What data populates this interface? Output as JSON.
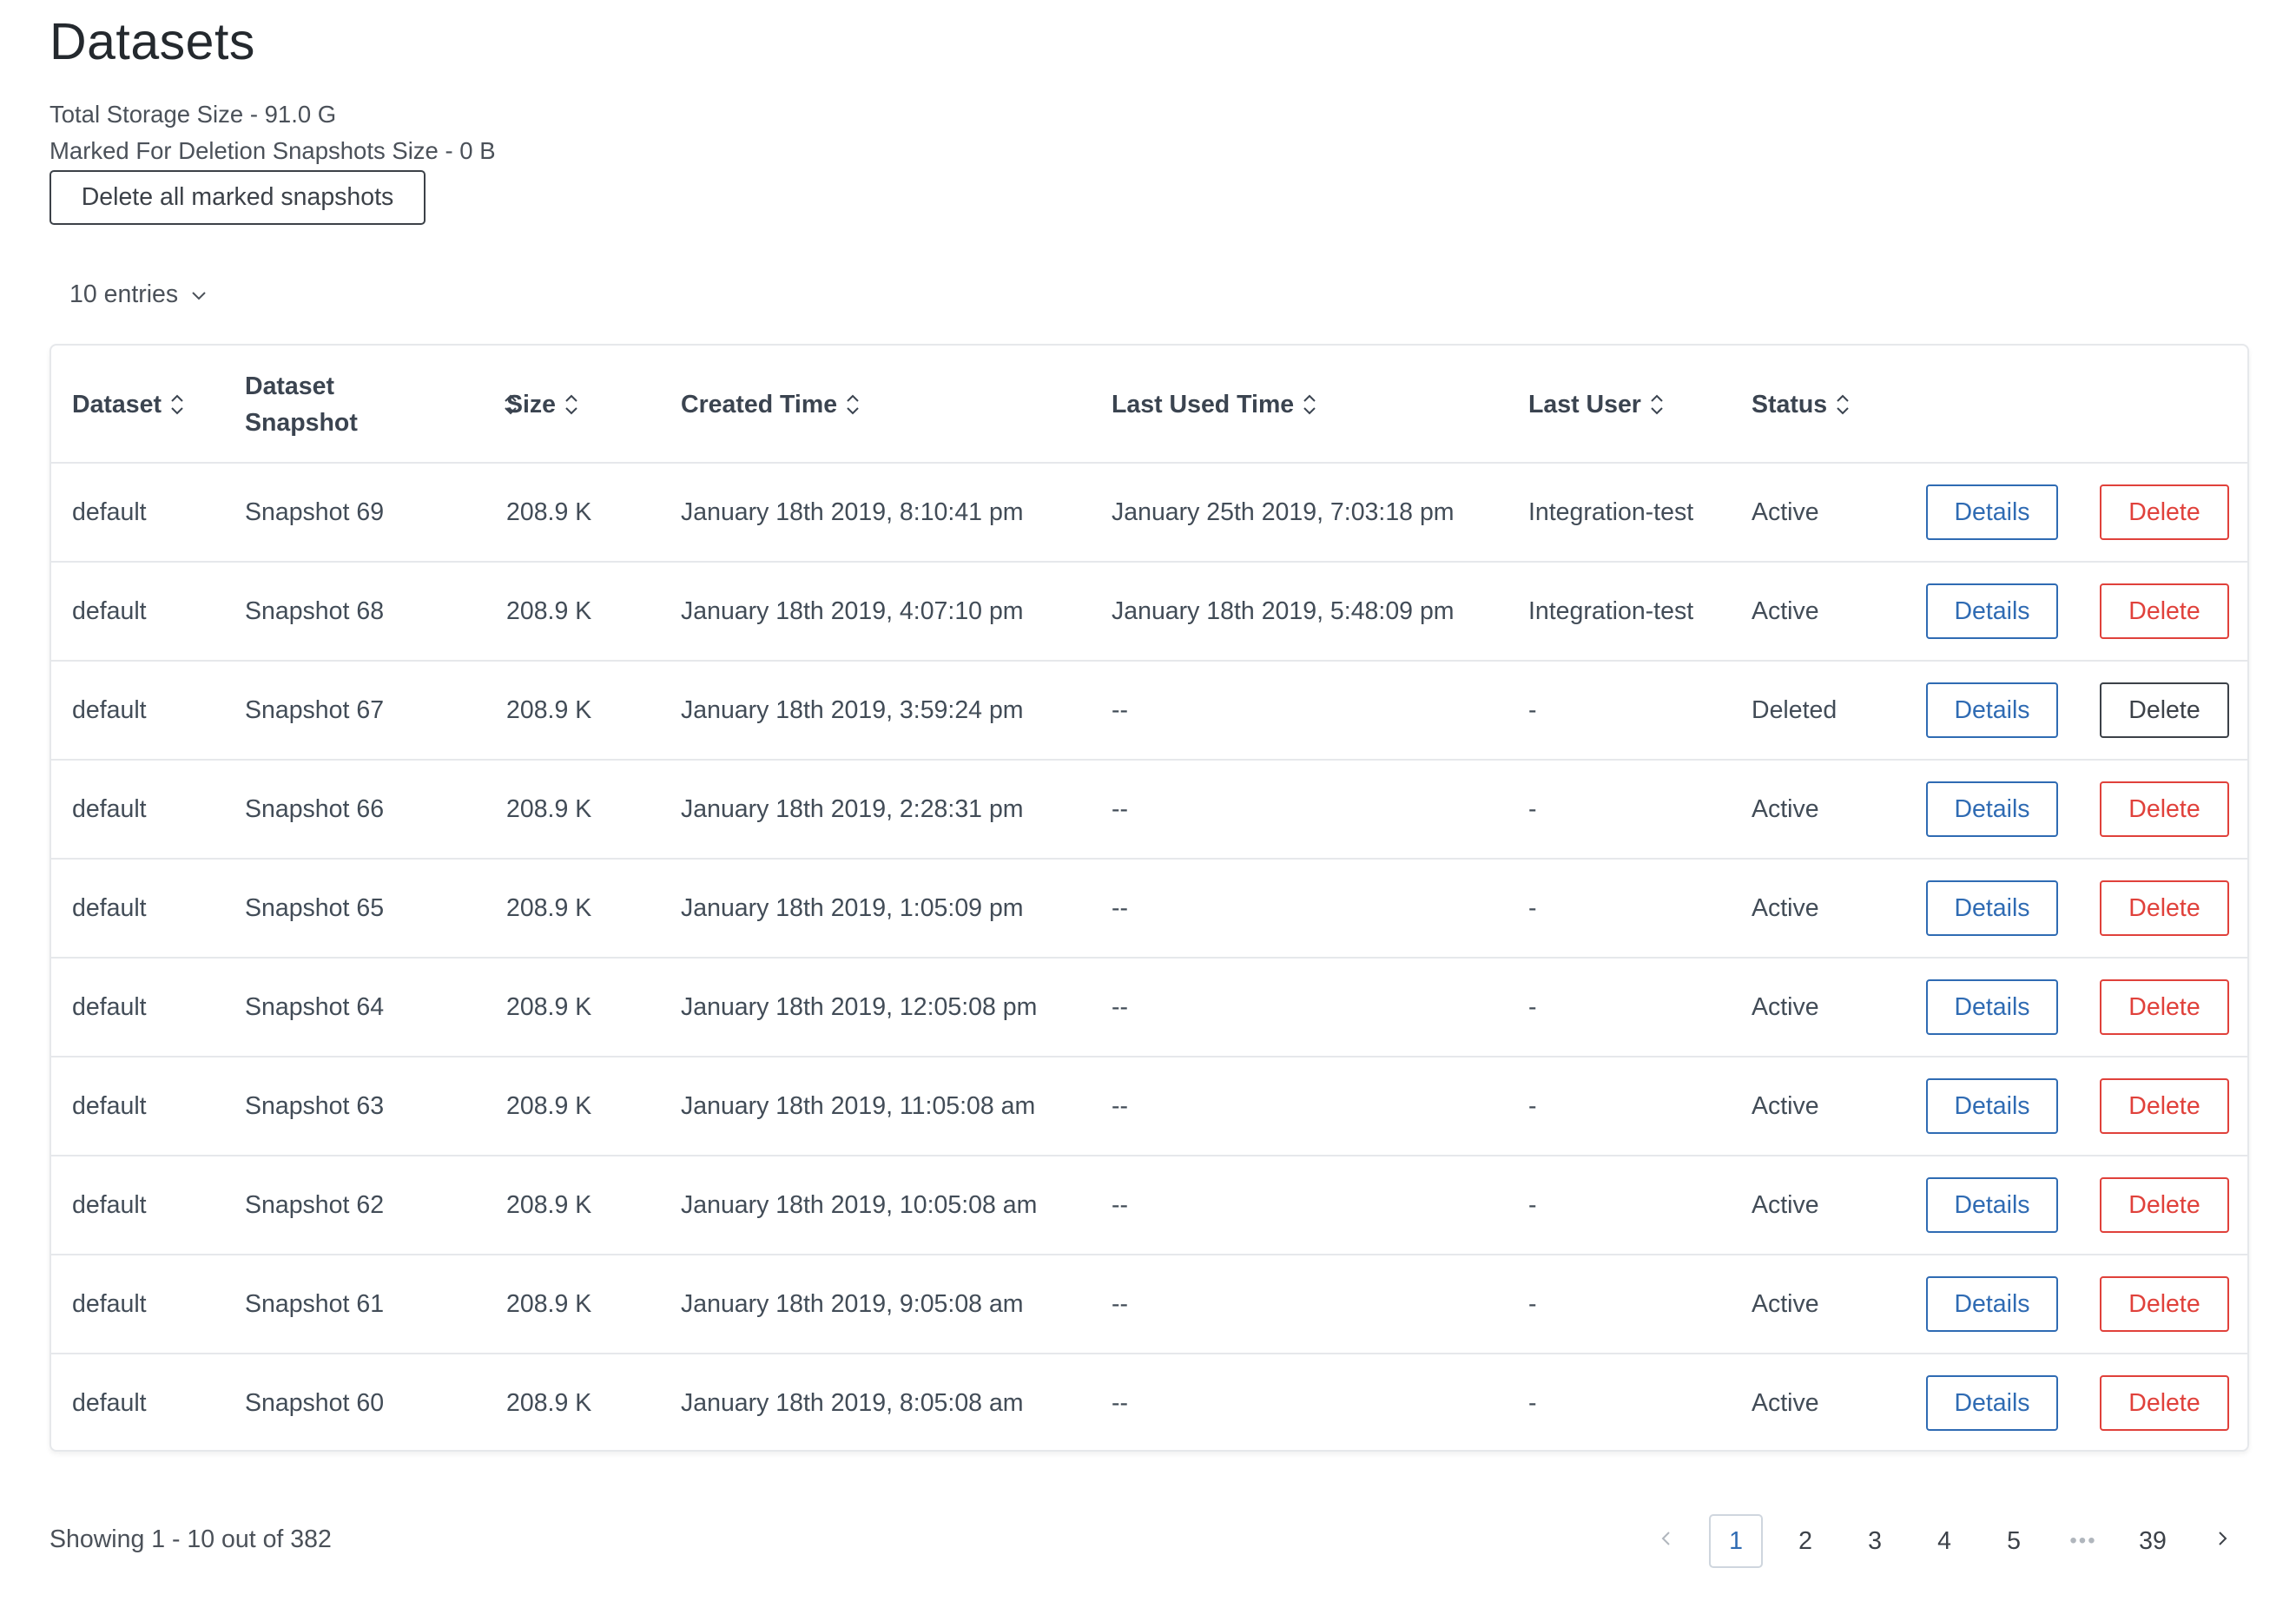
{
  "page": {
    "title": "Datasets",
    "total_storage": "Total Storage Size - 91.0 G",
    "marked_size": "Marked For Deletion Snapshots Size - 0 B",
    "delete_marked_label": "Delete all marked snapshots",
    "entries_label": "10 entries"
  },
  "table": {
    "headers": {
      "dataset": "Dataset",
      "snapshot_1": "Dataset",
      "snapshot_2": "Snapshot",
      "size": "Size",
      "created": "Created Time",
      "last_used": "Last Used Time",
      "last_user": "Last User",
      "status": "Status"
    },
    "rows": [
      {
        "dataset": "default",
        "snapshot": "Snapshot 69",
        "size": "208.9 K",
        "created": "January 18th 2019, 8:10:41 pm",
        "last_used": "January 25th 2019, 7:03:18 pm",
        "last_user": "Integration-test",
        "status": "Active",
        "details": "Details",
        "delete": "Delete"
      },
      {
        "dataset": "default",
        "snapshot": "Snapshot 68",
        "size": "208.9 K",
        "created": "January 18th 2019, 4:07:10 pm",
        "last_used": "January 18th 2019, 5:48:09 pm",
        "last_user": "Integration-test",
        "status": "Active",
        "details": "Details",
        "delete": "Delete"
      },
      {
        "dataset": "default",
        "snapshot": "Snapshot 67",
        "size": "208.9 K",
        "created": "January 18th 2019, 3:59:24 pm",
        "last_used": "--",
        "last_user": "-",
        "status": "Deleted",
        "details": "Details",
        "delete": "Delete"
      },
      {
        "dataset": "default",
        "snapshot": "Snapshot 66",
        "size": "208.9 K",
        "created": "January 18th 2019, 2:28:31 pm",
        "last_used": "--",
        "last_user": "-",
        "status": "Active",
        "details": "Details",
        "delete": "Delete"
      },
      {
        "dataset": "default",
        "snapshot": "Snapshot 65",
        "size": "208.9 K",
        "created": "January 18th 2019, 1:05:09 pm",
        "last_used": "--",
        "last_user": "-",
        "status": "Active",
        "details": "Details",
        "delete": "Delete"
      },
      {
        "dataset": "default",
        "snapshot": "Snapshot 64",
        "size": "208.9 K",
        "created": "January 18th 2019, 12:05:08 pm",
        "last_used": "--",
        "last_user": "-",
        "status": "Active",
        "details": "Details",
        "delete": "Delete"
      },
      {
        "dataset": "default",
        "snapshot": "Snapshot 63",
        "size": "208.9 K",
        "created": "January 18th 2019, 11:05:08 am",
        "last_used": "--",
        "last_user": "-",
        "status": "Active",
        "details": "Details",
        "delete": "Delete"
      },
      {
        "dataset": "default",
        "snapshot": "Snapshot 62",
        "size": "208.9 K",
        "created": "January 18th 2019, 10:05:08 am",
        "last_used": "--",
        "last_user": "-",
        "status": "Active",
        "details": "Details",
        "delete": "Delete"
      },
      {
        "dataset": "default",
        "snapshot": "Snapshot 61",
        "size": "208.9 K",
        "created": "January 18th 2019, 9:05:08 am",
        "last_used": "--",
        "last_user": "-",
        "status": "Active",
        "details": "Details",
        "delete": "Delete"
      },
      {
        "dataset": "default",
        "snapshot": "Snapshot 60",
        "size": "208.9 K",
        "created": "January 18th 2019, 8:05:08 am",
        "last_used": "--",
        "last_user": "-",
        "status": "Active",
        "details": "Details",
        "delete": "Delete"
      }
    ]
  },
  "footer": {
    "showing": "Showing 1 - 10 out of 382",
    "pages": [
      "1",
      "2",
      "3",
      "4",
      "5"
    ],
    "ellipsis": "•••",
    "last_page": "39",
    "current_page": "1"
  },
  "colors": {
    "primary": "#2f6bb3",
    "danger": "#e0413b",
    "border": "#e6e8eb",
    "text": "#424c57"
  },
  "icons": {
    "sort": "sort-icon",
    "chevron_down": "chevron-down-icon",
    "chevron_left": "chevron-left-icon",
    "chevron_right": "chevron-right-icon"
  }
}
